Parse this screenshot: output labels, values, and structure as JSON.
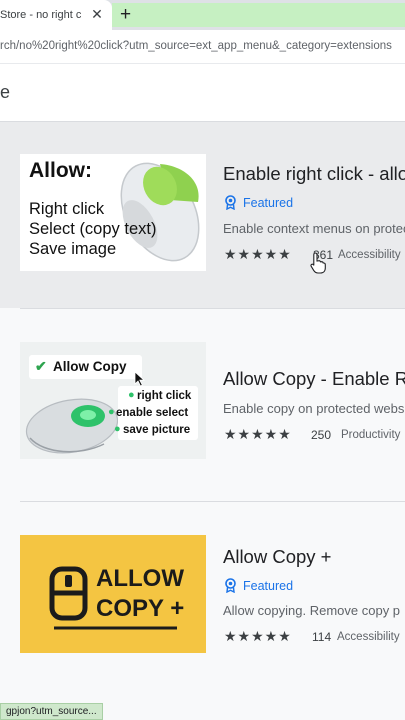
{
  "browser": {
    "tab_title": "Store - no right cli",
    "tab_close": "✕",
    "newtab_label": "+",
    "url": "rch/no%20right%20click?utm_source=ext_app_menu&_category=extensions",
    "search_fragment": "e",
    "status_url": "gpjon?utm_source..."
  },
  "colors": {
    "accent": "#1a73e8",
    "tab_highlight": "#c6f0c2",
    "stars": "#3c4043"
  },
  "results": [
    {
      "title": "Enable right click - allo",
      "badge": "Featured",
      "description": "Enable context menus on protect",
      "stars": "★★★★★",
      "rating_count": "361",
      "category": "Accessibility",
      "thumb": {
        "heading": "Allow:",
        "lines": [
          "Right click",
          "Select (copy text)",
          "Save image"
        ]
      }
    },
    {
      "title": "Allow Copy - Enable R",
      "description": "Enable copy on protected webs",
      "stars": "★★★★★",
      "rating_count": "250",
      "category": "Productivity",
      "thumb": {
        "heading": "Allow Copy",
        "items": [
          "right click",
          "enable select",
          "save picture"
        ]
      }
    },
    {
      "title": "Allow Copy +",
      "badge": "Featured",
      "description": "Allow copying. Remove copy p",
      "stars": "★★★★★",
      "rating_count": "114",
      "category": "Accessibility",
      "thumb": {
        "line1": "ALLOW",
        "line2": "COPY +"
      }
    }
  ]
}
